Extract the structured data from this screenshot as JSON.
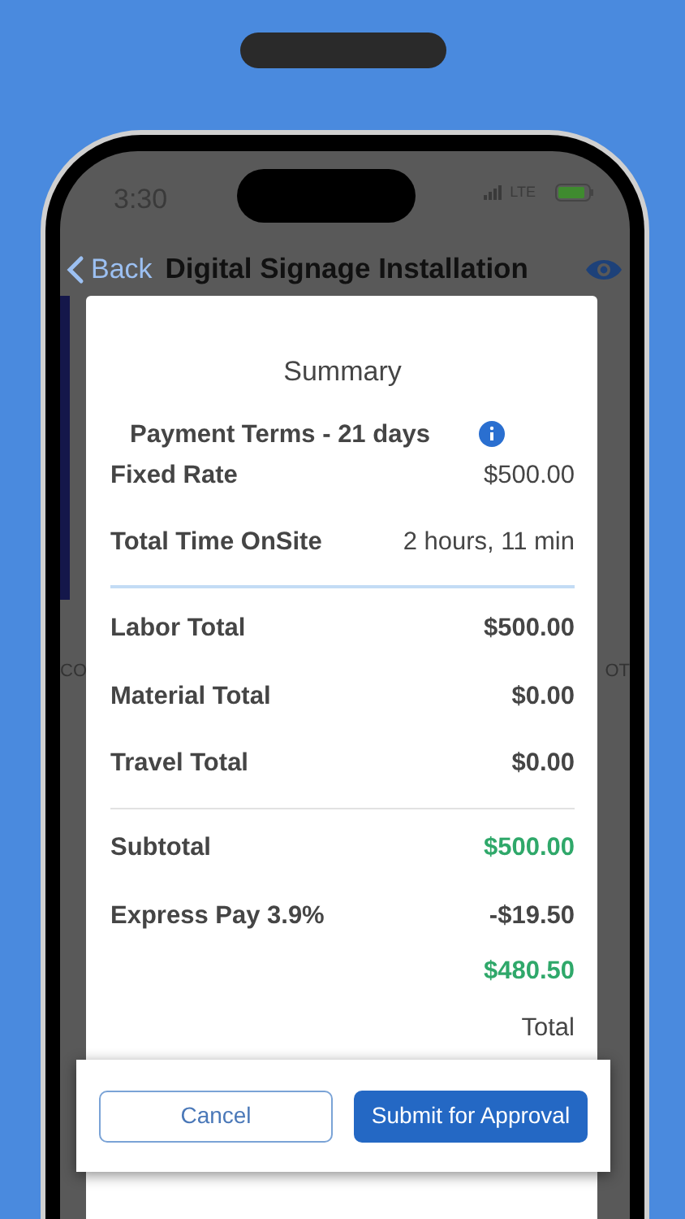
{
  "status_bar": {
    "time": "3:30",
    "network": "LTE"
  },
  "nav": {
    "back": "Back",
    "title": "Digital Signage Installation"
  },
  "background_fragments": [
    "CO",
    "OT"
  ],
  "summary": {
    "title": "Summary",
    "payment_terms": "Payment Terms - 21 days",
    "sections": [
      [
        {
          "label": "Fixed Rate",
          "value": "$500.00",
          "kind": "detail"
        },
        {
          "label": "Total Time OnSite",
          "value": "2 hours, 11 min",
          "kind": "detail"
        }
      ],
      [
        {
          "label": "Labor Total",
          "value": "$500.00",
          "kind": "total"
        },
        {
          "label": "Material Total",
          "value": "$0.00",
          "kind": "total"
        },
        {
          "label": "Travel Total",
          "value": "$0.00",
          "kind": "total"
        }
      ],
      [
        {
          "label": "Subtotal",
          "value": "$500.00",
          "kind": "credit"
        },
        {
          "label": "Express Pay 3.9%",
          "value": "-$19.50",
          "kind": "total"
        }
      ]
    ],
    "net_amount": "$480.50",
    "net_label": "Total"
  },
  "buttons": [
    {
      "label": "Cancel",
      "kind": "outline"
    },
    {
      "label": "Submit for Approval",
      "kind": "primary"
    }
  ]
}
